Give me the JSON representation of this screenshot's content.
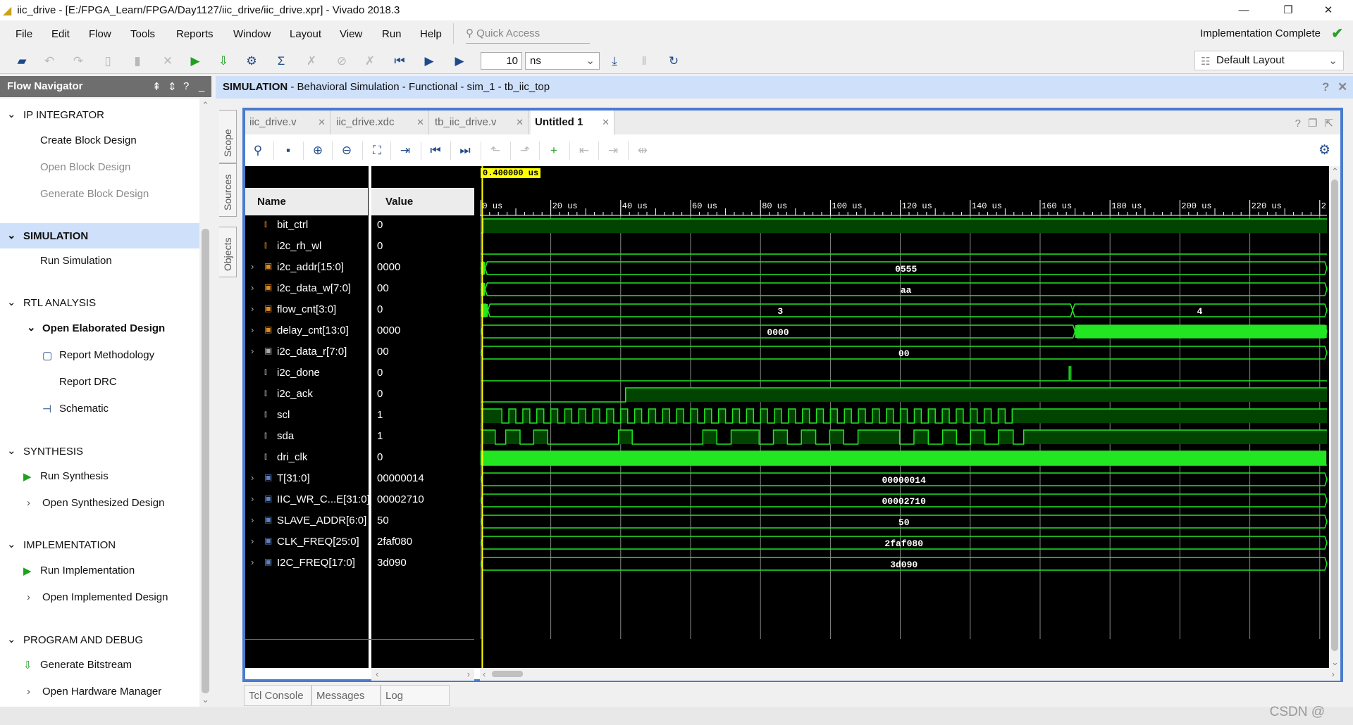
{
  "window": {
    "title": "iic_drive - [E:/FPGA_Learn/FPGA/Day1127/iic_drive/iic_drive.xpr] - Vivado 2018.3",
    "controls": [
      "—",
      "❐",
      "✕"
    ]
  },
  "menu": [
    "File",
    "Edit",
    "Flow",
    "Tools",
    "Reports",
    "Window",
    "Layout",
    "View",
    "Run",
    "Help"
  ],
  "quick_access": {
    "placeholder": "Quick Access",
    "icon": "search-icon"
  },
  "status": {
    "text": "Implementation Complete",
    "icon": "check-icon",
    "color": "#2ca02c"
  },
  "toolbar": {
    "run_for_value": "10",
    "run_for_unit": "ns",
    "layout": "Default Layout",
    "icons": [
      "open-project-icon",
      "undo-icon",
      "redo-icon",
      "copy-icon",
      "paste-icon",
      "delete-icon",
      "run-icon",
      "bitstream-icon",
      "settings-icon",
      "sigma-icon",
      "disabled-icon",
      "disabled-icon",
      "disabled-icon",
      "restart-icon",
      "run-all-icon",
      "run-for-icon"
    ],
    "icons_right": [
      "step-icon",
      "pause-icon",
      "relaunch-icon"
    ]
  },
  "flow_navigator": {
    "title": "Flow Navigator",
    "items": [
      {
        "type": "section",
        "label": "IP INTEGRATOR"
      },
      {
        "type": "item",
        "label": "Create Block Design"
      },
      {
        "type": "item",
        "label": "Open Block Design",
        "disabled": true
      },
      {
        "type": "item",
        "label": "Generate Block Design",
        "disabled": true
      },
      {
        "type": "section",
        "label": "SIMULATION",
        "selected": true
      },
      {
        "type": "item",
        "label": "Run Simulation"
      },
      {
        "type": "section",
        "label": "RTL ANALYSIS"
      },
      {
        "type": "sub",
        "label": "Open Elaborated Design"
      },
      {
        "type": "subitem",
        "label": "Report Methodology",
        "icon": "clipboard-icon"
      },
      {
        "type": "subitem",
        "label": "Report DRC"
      },
      {
        "type": "subitem",
        "label": "Schematic",
        "icon": "schematic-icon"
      },
      {
        "type": "section",
        "label": "SYNTHESIS"
      },
      {
        "type": "item",
        "label": "Run Synthesis",
        "icon": "play-icon"
      },
      {
        "type": "item",
        "label": "Open Synthesized Design",
        "chevron": true
      },
      {
        "type": "section",
        "label": "IMPLEMENTATION"
      },
      {
        "type": "item",
        "label": "Run Implementation",
        "icon": "play-icon"
      },
      {
        "type": "item",
        "label": "Open Implemented Design",
        "chevron": true
      },
      {
        "type": "section",
        "label": "PROGRAM AND DEBUG"
      },
      {
        "type": "item",
        "label": "Generate Bitstream",
        "icon": "bitstream-icon"
      },
      {
        "type": "item",
        "label": "Open Hardware Manager",
        "chevron": true
      }
    ]
  },
  "side_tabs": [
    "Scope",
    "Sources",
    "Objects"
  ],
  "sim_header": {
    "bold": "SIMULATION",
    "rest": " - Behavioral Simulation - Functional - sim_1 - tb_iic_top"
  },
  "editor_tabs": [
    {
      "label": "iic_drive.v"
    },
    {
      "label": "iic_drive.xdc"
    },
    {
      "label": "tb_iic_drive.v"
    },
    {
      "label": "Untitled 1",
      "active": true
    }
  ],
  "wave_toolbar": [
    "search-icon",
    "save-icon",
    "zoom-in-icon",
    "zoom-out-icon",
    "zoom-fit-icon",
    "go-to-cursor-icon",
    "go-to-start-icon",
    "go-to-end-icon",
    "previous-transition-icon",
    "next-transition-icon",
    "add-marker-icon",
    "previous-marker-icon",
    "next-marker-icon",
    "swap-cursors-icon"
  ],
  "wave": {
    "name_header": "Name",
    "value_header": "Value",
    "cursor_label": "0.400000 us",
    "cursor_time_us": 0.4,
    "time_unit": "us",
    "time_range_us": [
      0,
      242
    ],
    "ticks": [
      "0 us",
      "20 us",
      "40 us",
      "60 us",
      "80 us",
      "100 us",
      "120 us",
      "140 us",
      "160 us",
      "180 us",
      "200 us",
      "220 us",
      "2"
    ],
    "colors": {
      "wave": "#22e622",
      "fill": "#004400",
      "cursor": "#ffff00",
      "grid": "#ffffff"
    },
    "signals": [
      {
        "name": "bit_ctrl",
        "value": "0",
        "kind": "bit",
        "icon": "orange",
        "tr": [
          [
            0,
            0
          ],
          [
            0.6,
            1
          ]
        ]
      },
      {
        "name": "i2c_rh_wl",
        "value": "0",
        "kind": "bit",
        "icon": "orange",
        "tr": [
          [
            0,
            0
          ]
        ]
      },
      {
        "name": "i2c_addr[15:0]",
        "value": "0000",
        "kind": "bus",
        "icon": "orange",
        "seg": [
          [
            0,
            ""
          ],
          [
            1.2,
            "0555"
          ]
        ],
        "dense": [
          [
            0,
            1.2
          ]
        ]
      },
      {
        "name": "i2c_data_w[7:0]",
        "value": "00",
        "kind": "bus",
        "icon": "orange",
        "seg": [
          [
            0,
            ""
          ],
          [
            1.2,
            "aa"
          ]
        ],
        "dense": [
          [
            0,
            1.2
          ]
        ]
      },
      {
        "name": "flow_cnt[3:0]",
        "value": "0",
        "kind": "bus",
        "icon": "orange",
        "seg": [
          [
            0,
            ""
          ],
          [
            2,
            "3"
          ],
          [
            169.3,
            "4"
          ]
        ],
        "dense": [
          [
            0,
            2
          ]
        ]
      },
      {
        "name": "delay_cnt[13:0]",
        "value": "0000",
        "kind": "bus",
        "icon": "orange",
        "seg": [
          [
            0,
            "0000"
          ],
          [
            170,
            ""
          ]
        ],
        "dense": [
          [
            170,
            242
          ]
        ]
      },
      {
        "name": "i2c_data_r[7:0]",
        "value": "00",
        "kind": "bus",
        "icon": "gray",
        "seg": [
          [
            0,
            "00"
          ]
        ]
      },
      {
        "name": "i2c_done",
        "value": "0",
        "kind": "bit",
        "icon": "gray",
        "tr": [
          [
            0,
            0
          ],
          [
            168.3,
            1
          ],
          [
            168.8,
            0
          ]
        ]
      },
      {
        "name": "i2c_ack",
        "value": "0",
        "kind": "bit",
        "icon": "gray",
        "tr": [
          [
            0,
            0
          ],
          [
            41.4,
            1
          ]
        ]
      },
      {
        "name": "scl",
        "value": "1",
        "kind": "bit",
        "icon": "gray",
        "clock": {
          "init": 1,
          "start": 6,
          "period": 4,
          "cycles": 37
        }
      },
      {
        "name": "sda",
        "value": "1",
        "kind": "bit",
        "icon": "gray",
        "tr": [
          [
            0,
            1
          ],
          [
            4.1,
            0
          ],
          [
            7.1,
            1
          ],
          [
            11.2,
            0
          ],
          [
            15.1,
            1
          ],
          [
            19.1,
            0
          ],
          [
            39.4,
            1
          ],
          [
            43.3,
            0
          ],
          [
            63.5,
            1
          ],
          [
            67.5,
            0
          ],
          [
            71.6,
            1
          ],
          [
            79.6,
            0
          ],
          [
            83.7,
            1
          ],
          [
            87.7,
            0
          ],
          [
            91.7,
            1
          ],
          [
            95.8,
            0
          ],
          [
            99.8,
            1
          ],
          [
            103.8,
            0
          ],
          [
            107.9,
            1
          ],
          [
            119.8,
            0
          ],
          [
            123.9,
            1
          ],
          [
            128,
            0
          ],
          [
            132.1,
            1
          ],
          [
            136.1,
            0
          ],
          [
            140.1,
            1
          ],
          [
            144.2,
            0
          ],
          [
            148.1,
            1
          ],
          [
            152.3,
            0
          ],
          [
            155.3,
            1
          ]
        ]
      },
      {
        "name": "dri_clk",
        "value": "0",
        "kind": "bit",
        "icon": "gray",
        "clock": {
          "init": 0,
          "start": 0,
          "period": 0.5,
          "cycles": 484,
          "full": true
        }
      },
      {
        "name": "T[31:0]",
        "value": "00000014",
        "kind": "bus",
        "icon": "blue",
        "seg": [
          [
            0,
            "00000014"
          ]
        ]
      },
      {
        "name": "IIC_WR_C...E[31:0]",
        "value": "00002710",
        "kind": "bus",
        "icon": "blue",
        "seg": [
          [
            0,
            "00002710"
          ]
        ]
      },
      {
        "name": "SLAVE_ADDR[6:0]",
        "value": "50",
        "kind": "bus",
        "icon": "blue",
        "seg": [
          [
            0,
            "50"
          ]
        ]
      },
      {
        "name": "CLK_FREQ[25:0]",
        "value": "2faf080",
        "kind": "bus",
        "icon": "blue",
        "seg": [
          [
            0,
            "2faf080"
          ]
        ]
      },
      {
        "name": "I2C_FREQ[17:0]",
        "value": "3d090",
        "kind": "bus",
        "icon": "blue",
        "seg": [
          [
            0,
            "3d090"
          ]
        ]
      }
    ]
  },
  "bottom_tabs": [
    "Tcl Console",
    "Messages",
    "Log"
  ],
  "watermark": "CSDN @"
}
